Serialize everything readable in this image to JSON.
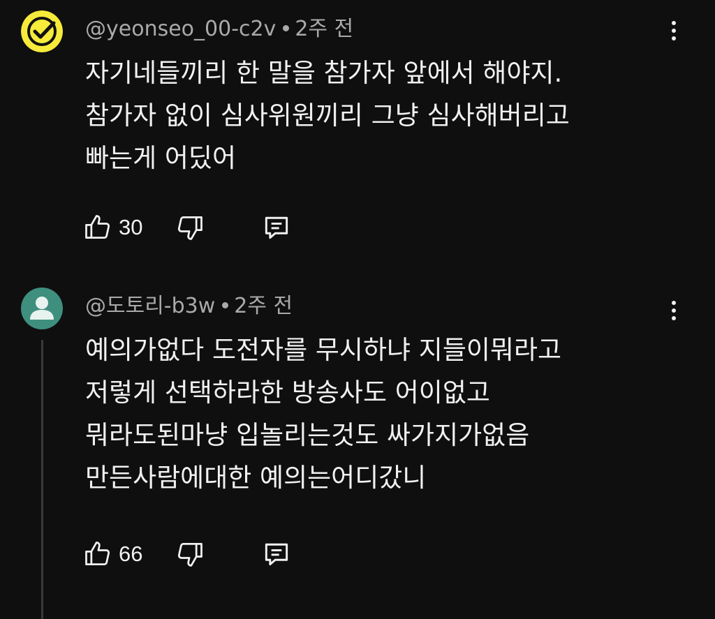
{
  "comments": [
    {
      "handle": "@yeonseo_00-c2v",
      "time": "2주 전",
      "lines": [
        "자기네들끼리 한 말을 참가자 앞에서 해야지.",
        "참가자 없이 심사위원끼리 그냥 심사해버리고",
        "빠는게 어딨어"
      ],
      "likes": "30",
      "avatar": {
        "type": "checkmark-badge",
        "color": "#f6eb3a"
      }
    },
    {
      "handle": "@도토리-b3w",
      "time": "2주 전",
      "lines": [
        "예의가없다 도전자를 무시하냐 지들이뭐라고",
        "저렇게 선택하라한 방송사도 어이없고",
        "뭐라도된마냥 입놀리는것도 싸가지가없음",
        "만든사람에대한 예의는어디갔니"
      ],
      "likes": "66",
      "avatar": {
        "type": "default-person",
        "color": "#3f8f7f"
      }
    }
  ],
  "icons": {
    "like": "thumbs-up-icon",
    "dislike": "thumbs-down-icon",
    "reply": "comment-icon",
    "more": "more-vertical-icon"
  }
}
